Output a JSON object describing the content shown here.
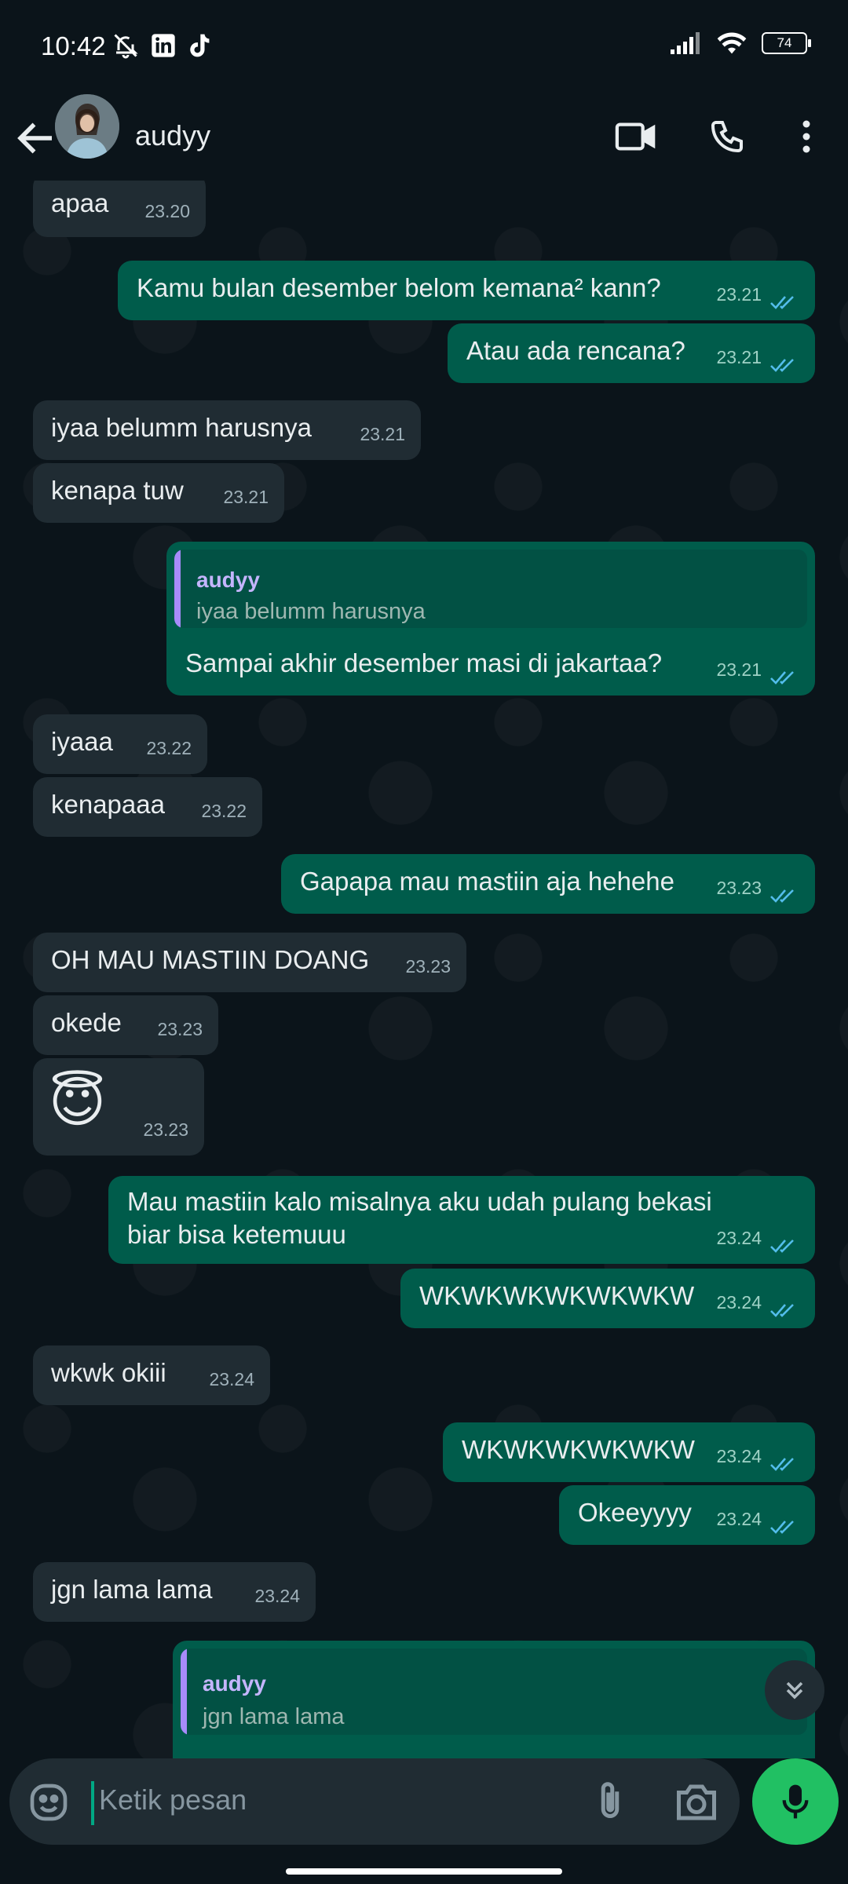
{
  "status_bar": {
    "time": "10:42",
    "battery": "74"
  },
  "header": {
    "contact_name": "audyy"
  },
  "messages": [
    {
      "text": "apaa",
      "time": "23.20"
    },
    {
      "text": "Kamu bulan desember belom kemana² kann?",
      "time": "23.21"
    },
    {
      "text": "Atau ada rencana?",
      "time": "23.21"
    },
    {
      "text": "iyaa belumm harusnya",
      "time": "23.21"
    },
    {
      "text": "kenapa tuw",
      "time": "23.21"
    },
    {
      "quote_name": "audyy",
      "quote_text": "iyaa belumm harusnya",
      "text": "Sampai akhir desember masi di jakartaa?",
      "time": "23.21"
    },
    {
      "text": "iyaaa",
      "time": "23.22"
    },
    {
      "text": "kenapaaa",
      "time": "23.22"
    },
    {
      "text": "Gapapa mau mastiin aja hehehe",
      "time": "23.23"
    },
    {
      "text": "OH MAU MASTIIN DOANG",
      "time": "23.23"
    },
    {
      "text": "okede",
      "time": "23.23"
    },
    {
      "text": "😇",
      "time": "23.23"
    },
    {
      "text_line1": "Mau mastiin kalo misalnya aku udah pulang bekasi",
      "text_line2": "biar bisa ketemuuu",
      "time": "23.24"
    },
    {
      "text": "WKWKWKWKWKWKW",
      "time": "23.24"
    },
    {
      "text": "wkwk okiii",
      "time": "23.24"
    },
    {
      "text": "WKWKWKWKWKW",
      "time": "23.24"
    },
    {
      "text": "Okeeyyyy",
      "time": "23.24"
    },
    {
      "text": "jgn lama lama",
      "time": "23.24"
    },
    {
      "quote_name": "audyy",
      "quote_text": "jgn lama lama"
    }
  ],
  "input": {
    "placeholder": "Ketik pesan"
  },
  "colors": {
    "background": "#0b141a",
    "incoming": "#202c33",
    "outgoing": "#005c4b",
    "accent": "#21c063",
    "read_ticks": "#53bdeb"
  }
}
